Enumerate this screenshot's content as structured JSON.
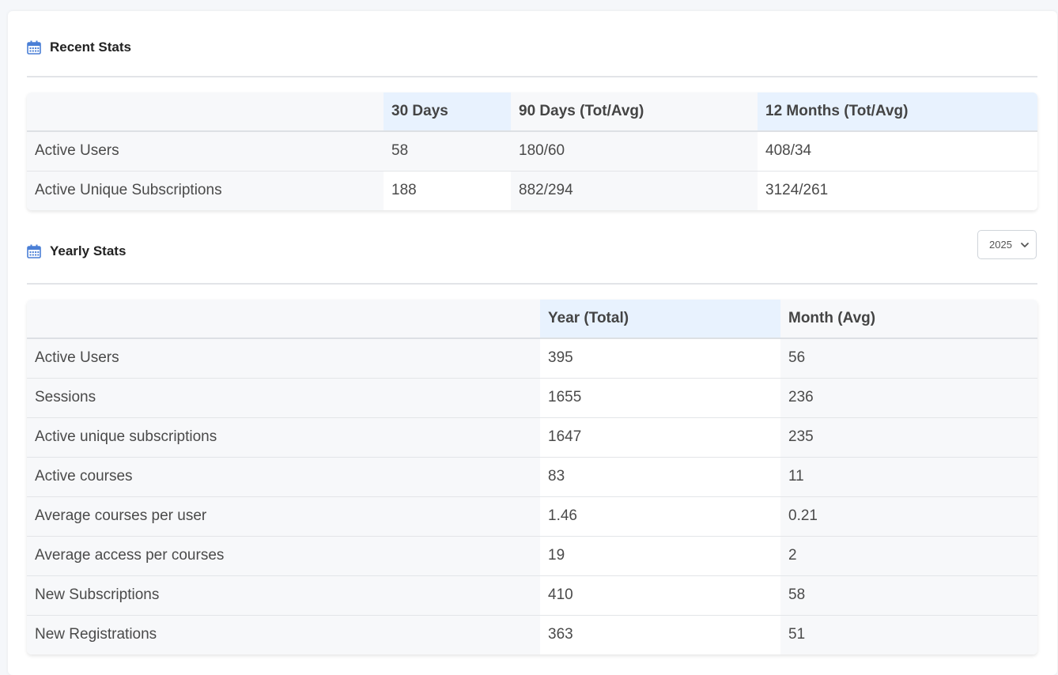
{
  "recent": {
    "title": "Recent Stats",
    "headers": [
      "",
      "30 Days",
      "90 Days (Tot/Avg)",
      "12 Months (Tot/Avg)"
    ],
    "rows": [
      [
        "Active Users",
        "58",
        "180/60",
        "408/34"
      ],
      [
        "Active Unique Subscriptions",
        "188",
        "882/294",
        "3124/261"
      ]
    ]
  },
  "yearly": {
    "title": "Yearly Stats",
    "year_select": {
      "value": "2025"
    },
    "headers": [
      "",
      "Year (Total)",
      "Month (Avg)"
    ],
    "rows": [
      [
        "Active Users",
        "395",
        "56"
      ],
      [
        "Sessions",
        "1655",
        "236"
      ],
      [
        "Active unique subscriptions",
        "1647",
        "235"
      ],
      [
        "Active courses",
        "83",
        "11"
      ],
      [
        "Average courses per user",
        "1.46",
        "0.21"
      ],
      [
        "Average access per courses",
        "19",
        "2"
      ],
      [
        "New Subscriptions",
        "410",
        "58"
      ],
      [
        "New Registrations",
        "363",
        "51"
      ]
    ]
  },
  "icons": {
    "section": "calendar-icon",
    "select": "chevron-down-icon"
  },
  "colors": {
    "accent": "#4a7fd6",
    "highlight_col": "#e8f2fe"
  }
}
